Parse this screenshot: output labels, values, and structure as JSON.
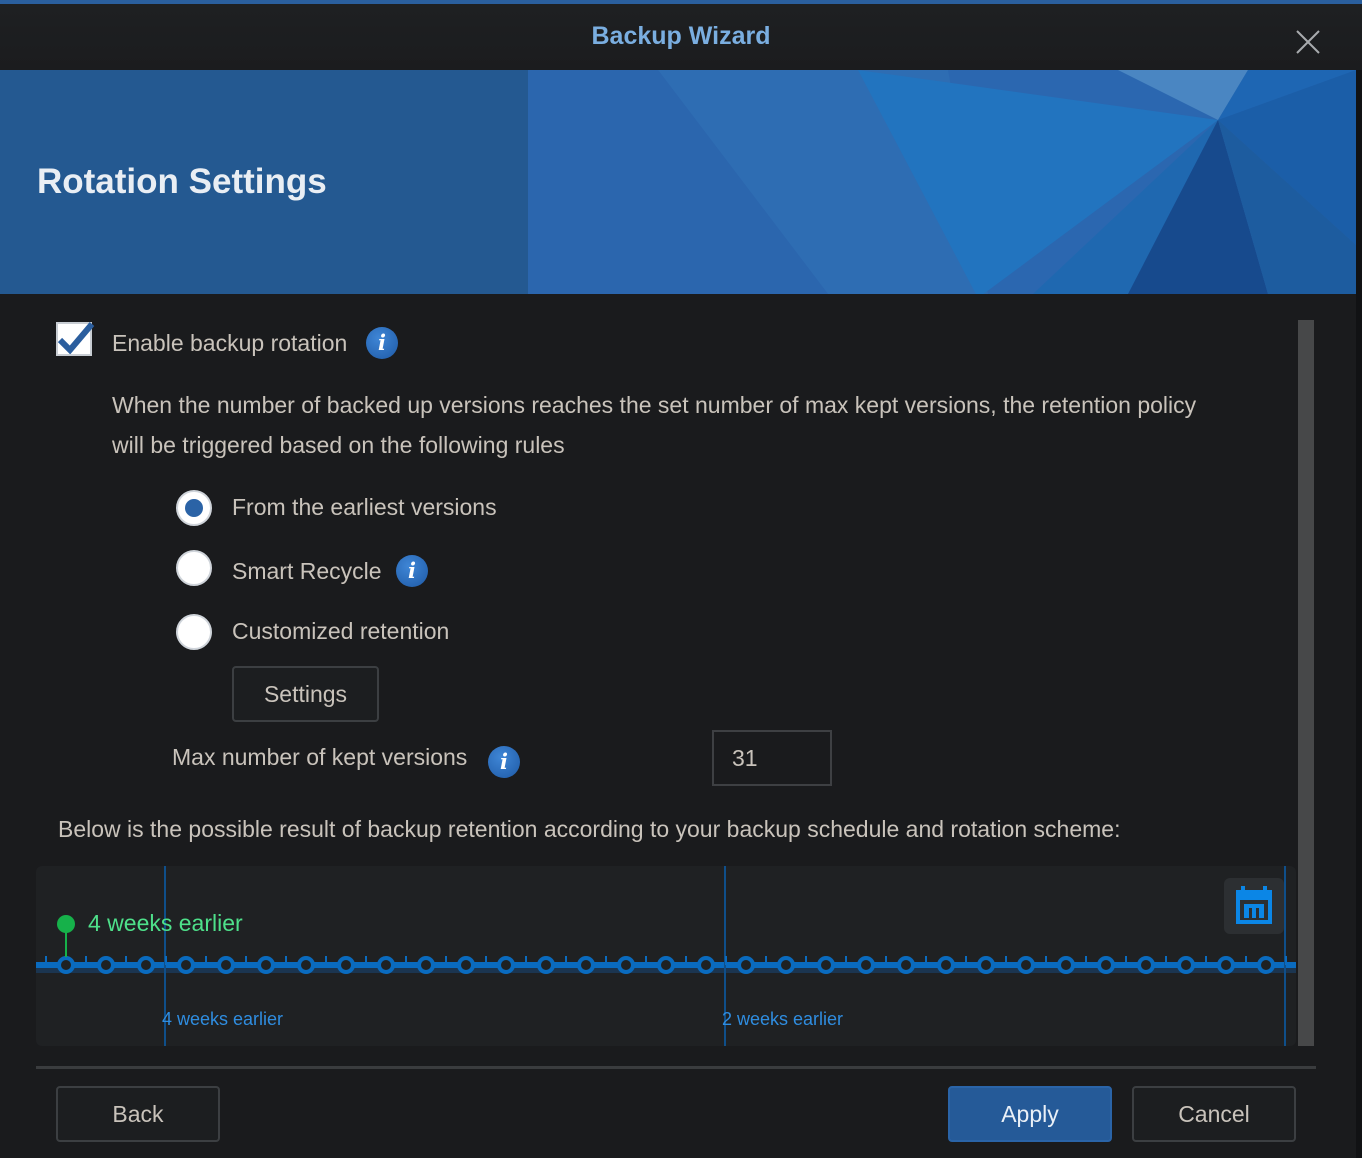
{
  "window": {
    "title": "Backup Wizard",
    "close_icon": "close-icon"
  },
  "banner": {
    "title": "Rotation Settings"
  },
  "rotation": {
    "enable_label": "Enable backup rotation",
    "enabled": true,
    "description_line1": "When the number of backed up versions reaches the set number of max kept versions, the retention policy",
    "description_line2": "will be triggered based on the following rules",
    "options": [
      {
        "label": "From the earliest versions",
        "selected": true,
        "has_info": false
      },
      {
        "label": "Smart Recycle",
        "selected": false,
        "has_info": true
      },
      {
        "label": "Customized retention",
        "selected": false,
        "has_info": false
      }
    ],
    "settings_button": "Settings",
    "max_versions_label": "Max number of kept versions",
    "max_versions_value": "31"
  },
  "timeline": {
    "intro": "Below is the possible result of backup retention according to your backup schedule and rotation scheme:",
    "kept_versions": 31,
    "marker_label": "4 weeks earlier",
    "axis_labels": [
      {
        "label": "4 weeks earlier",
        "index": 2.5
      },
      {
        "label": "2 weeks earlier",
        "index": 16.5
      }
    ],
    "calendar_icon": "calendar-icon",
    "colors": {
      "line": "#0a6bbf",
      "marker": "#16b14a",
      "marker_text": "#4ee08a",
      "axis_text": "#2f8de0"
    }
  },
  "footer": {
    "back": "Back",
    "apply": "Apply",
    "cancel": "Cancel"
  }
}
